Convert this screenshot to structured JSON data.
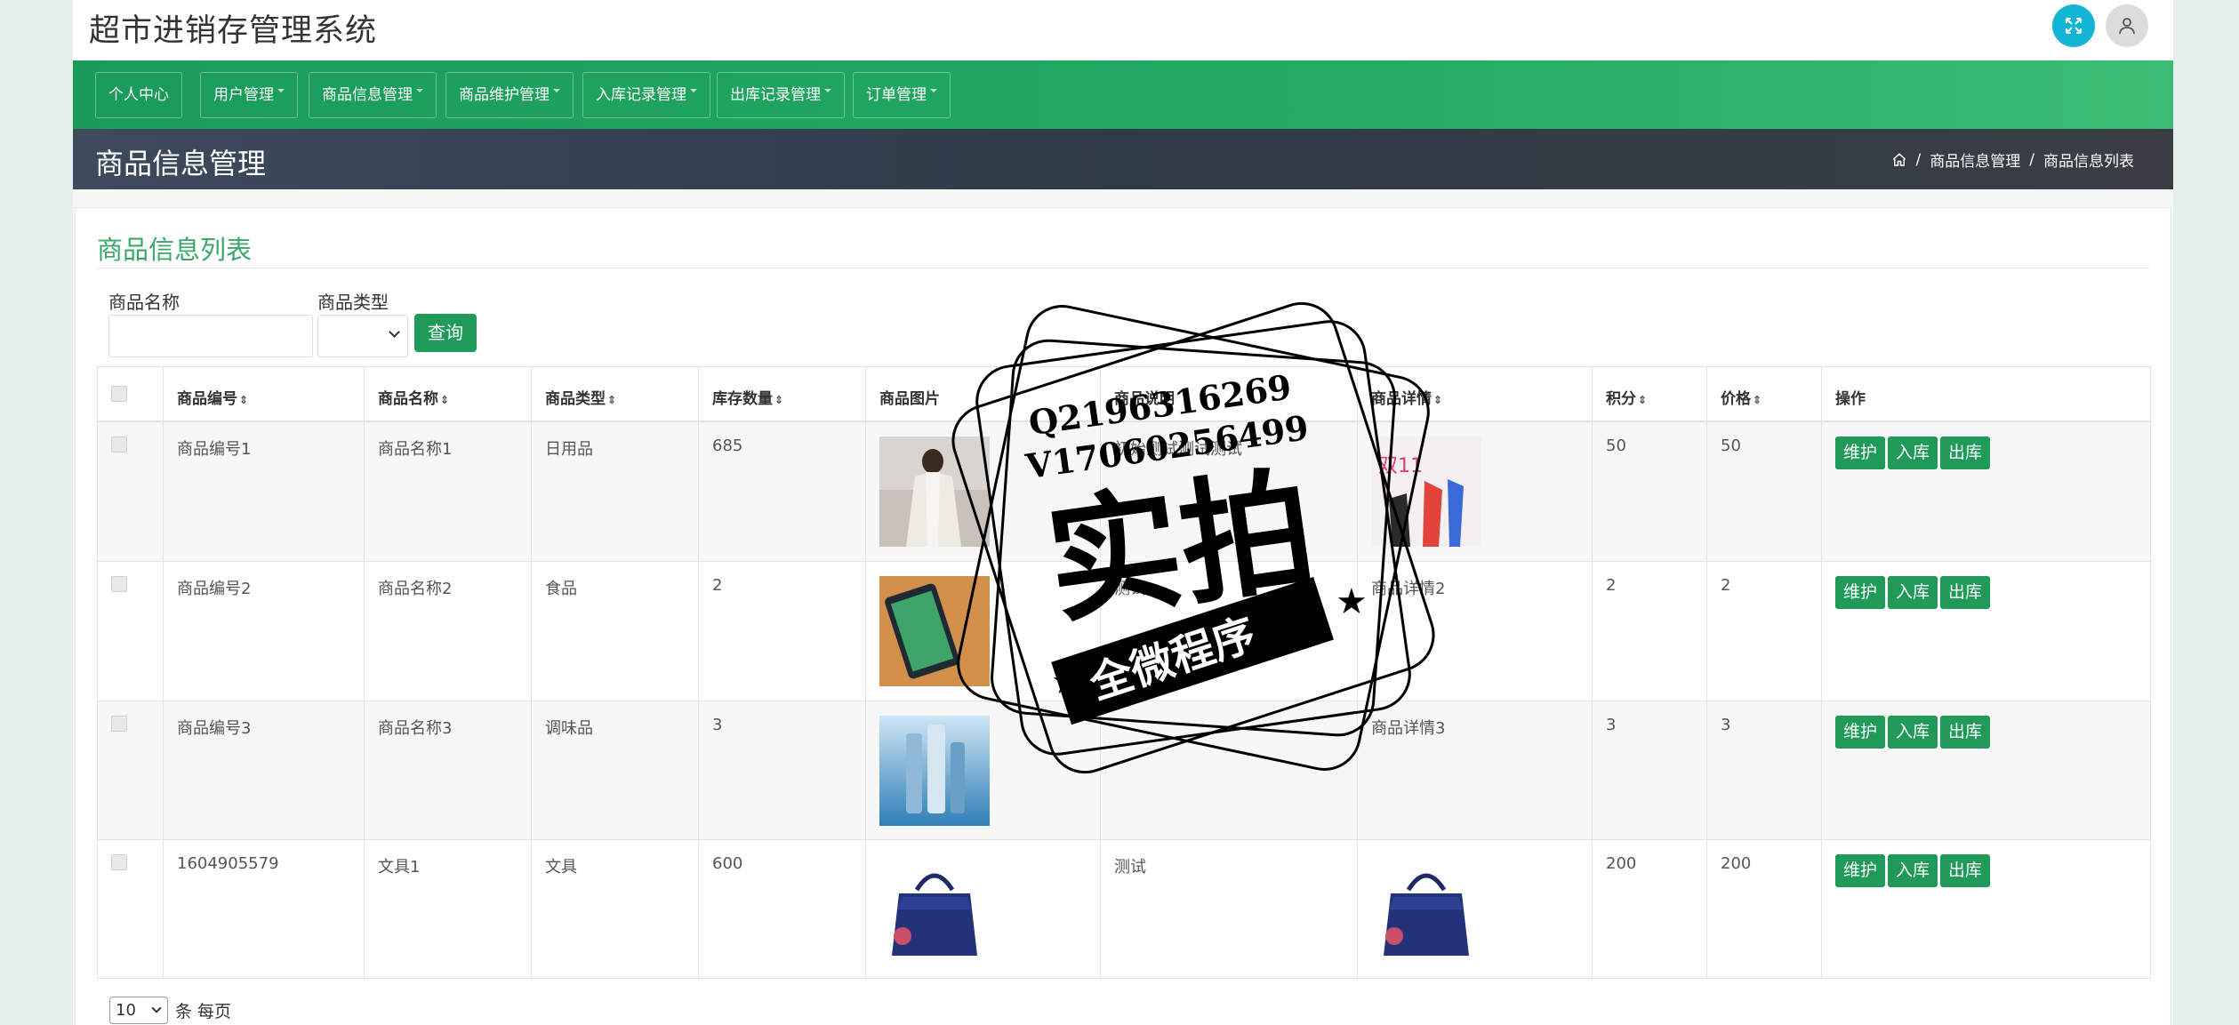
{
  "app": {
    "title": "超市进销存管理系统"
  },
  "nav": {
    "items": [
      {
        "label": "个人中心",
        "dropdown": false
      },
      {
        "label": "用户管理",
        "dropdown": true
      },
      {
        "label": "商品信息管理",
        "dropdown": true
      },
      {
        "label": "商品维护管理",
        "dropdown": true
      },
      {
        "label": "入库记录管理",
        "dropdown": true
      },
      {
        "label": "出库记录管理",
        "dropdown": true
      },
      {
        "label": "订单管理",
        "dropdown": true
      }
    ]
  },
  "page": {
    "title": "商品信息管理",
    "breadcrumb": [
      "商品信息管理",
      "商品信息列表"
    ]
  },
  "card": {
    "title": "商品信息列表"
  },
  "search": {
    "name_label": "商品名称",
    "name_value": "",
    "type_label": "商品类型",
    "type_value": "",
    "submit_label": "查询"
  },
  "table": {
    "headers": [
      "商品编号",
      "商品名称",
      "商品类型",
      "库存数量",
      "商品图片",
      "商品说明",
      "商品详情",
      "积分",
      "价格",
      "操作"
    ],
    "rows": [
      {
        "code": "商品编号1",
        "name": "商品名称1",
        "type": "日用品",
        "stock": "685",
        "image": "photo-woman-coat",
        "desc": "初始测试测试测试",
        "detail_image": "poster-shopping",
        "detail": "",
        "points": "50",
        "price": "50"
      },
      {
        "code": "商品编号2",
        "name": "商品名称2",
        "type": "食品",
        "stock": "2",
        "image": "photo-tablet",
        "desc": "测试",
        "detail_image": "",
        "detail": "商品详情2",
        "points": "2",
        "price": "2"
      },
      {
        "code": "商品编号3",
        "name": "商品名称3",
        "type": "调味品",
        "stock": "3",
        "image": "photo-bottles",
        "desc": "",
        "detail_image": "",
        "detail": "商品详情3",
        "points": "3",
        "price": "3"
      },
      {
        "code": "1604905579",
        "name": "文具1",
        "type": "文具",
        "stock": "600",
        "image": "photo-handbag",
        "desc": "测试",
        "detail_image": "photo-handbag",
        "detail": "",
        "points": "200",
        "price": "200"
      }
    ],
    "actions": [
      "维护",
      "入库",
      "出库"
    ]
  },
  "pager": {
    "page_size": "10",
    "suffix": "条 每页"
  },
  "watermark": {
    "lines": [
      "Q2196316269",
      "V17060256499",
      "实拍",
      "全微程序"
    ]
  },
  "colors": {
    "brand_green": "#1f9a58",
    "nav_green": "#23ab63",
    "title_green": "#3aa86a",
    "header_dark": "#2f3a48",
    "accent_cyan": "#13b5d6"
  }
}
